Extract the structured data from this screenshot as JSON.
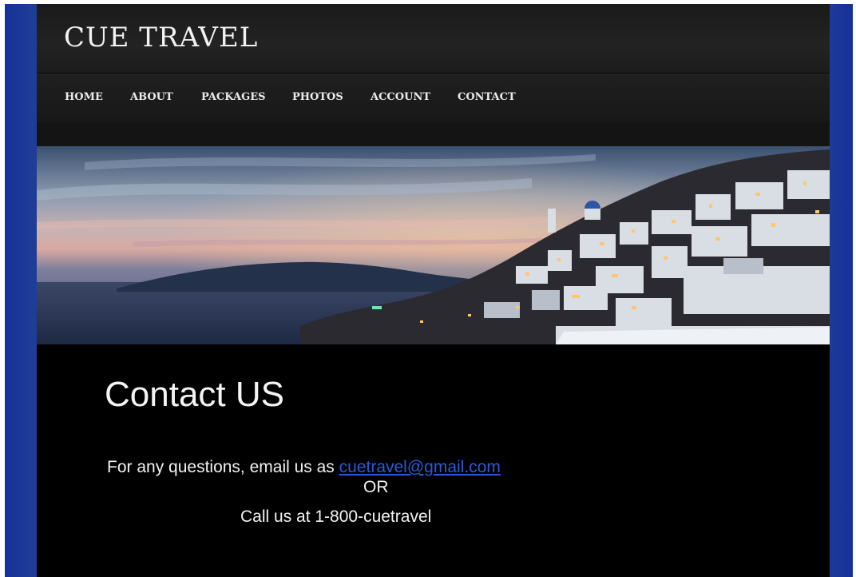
{
  "site": {
    "logo": "CUE TRAVEL"
  },
  "nav": {
    "items": [
      {
        "label": "HOME"
      },
      {
        "label": "ABOUT"
      },
      {
        "label": "PACKAGES"
      },
      {
        "label": "PHOTOS"
      },
      {
        "label": "ACCOUNT"
      },
      {
        "label": "CONTACT"
      }
    ]
  },
  "contact": {
    "heading": "Contact US",
    "email_prefix": "For any questions, email us as ",
    "email": "cuetravel@gmail.com",
    "or_text": "OR",
    "phone_text": "Call  us at 1-800-cuetravel"
  },
  "colors": {
    "frame_blue": "#1c3a94",
    "link_blue": "#2a5ad8",
    "background": "#000000"
  }
}
